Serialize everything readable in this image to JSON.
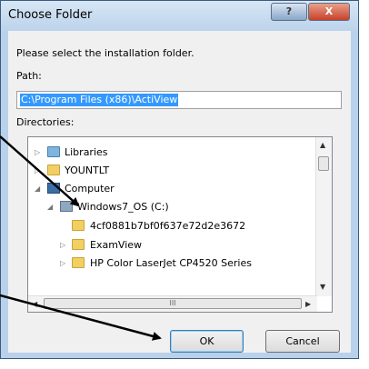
{
  "window": {
    "title": "Choose Folder",
    "help_label": "?",
    "close_label": "X"
  },
  "dialog": {
    "prompt": "Please select the installation folder.",
    "path_label": "Path:",
    "path_value": "C:\\Program Files (x86)\\ActiView",
    "directories_label": "Directories:"
  },
  "tree": {
    "items": [
      {
        "label": "Libraries",
        "icon": "libraries-icon"
      },
      {
        "label": "YOUNTLT",
        "icon": "user-folder-icon"
      },
      {
        "label": "Computer",
        "icon": "computer-icon"
      },
      {
        "label": "Windows7_OS (C:)",
        "icon": "drive-icon"
      },
      {
        "label": "4cf0881b7bf0f637e72d2e3672",
        "icon": "folder-icon"
      },
      {
        "label": "ExamView",
        "icon": "folder-icon"
      },
      {
        "label": "HP Color LaserJet CP4520 Series",
        "icon": "folder-icon"
      }
    ],
    "hscroll_grip": "III"
  },
  "buttons": {
    "ok": "OK",
    "cancel": "Cancel"
  }
}
